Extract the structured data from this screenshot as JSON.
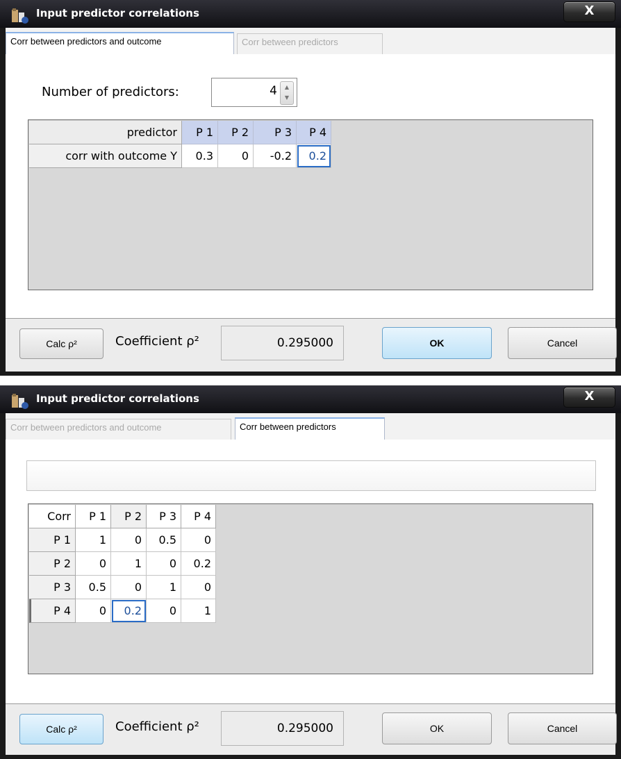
{
  "window1": {
    "title": "Input predictor correlations",
    "close_glyph": "X",
    "tabs": [
      "Corr between predictors and outcome",
      "Corr between predictors"
    ],
    "active_tab": 0,
    "num_predictors_label": "Number of predictors:",
    "num_predictors_value": "4",
    "table": {
      "corner": "predictor",
      "headers": [
        "P 1",
        "P 2",
        "P 3",
        "P 4"
      ],
      "row_label": "corr with outcome Y",
      "values": [
        "0.3",
        "0",
        "-0.2",
        "0.2"
      ],
      "selected_index": 3
    },
    "calc_button": "Calc ρ²",
    "coef_label": "Coefficient ρ²",
    "coef_value": "0.295000",
    "ok_button": "OK",
    "cancel_button": "Cancel",
    "focused_button": "OK"
  },
  "window2": {
    "title": "Input predictor correlations",
    "close_glyph": "X",
    "tabs": [
      "Corr between predictors and outcome",
      "Corr between predictors"
    ],
    "active_tab": 1,
    "matrix": {
      "corner": "Corr",
      "headers": [
        "P 1",
        "P 2",
        "P 3",
        "P 4"
      ],
      "rows": [
        {
          "label": "P 1",
          "values": [
            "1",
            "0",
            "0.5",
            "0"
          ]
        },
        {
          "label": "P 2",
          "values": [
            "0",
            "1",
            "0",
            "0.2"
          ]
        },
        {
          "label": "P 3",
          "values": [
            "0.5",
            "0",
            "1",
            "0"
          ]
        },
        {
          "label": "P 4",
          "values": [
            "0",
            "0.2",
            "0",
            "1"
          ]
        }
      ],
      "selected_cell": {
        "row": 3,
        "col": 1
      }
    },
    "calc_button": "Calc ρ²",
    "coef_label": "Coefficient ρ²",
    "coef_value": "0.295000",
    "ok_button": "OK",
    "cancel_button": "Cancel",
    "focused_button": "Calc ρ²"
  },
  "colors": {
    "titlebar": "#1a1a1a",
    "header_blue": "#c9d3ee",
    "selection_border": "#2a6cc6",
    "focus_button": "#bfe3f8"
  }
}
